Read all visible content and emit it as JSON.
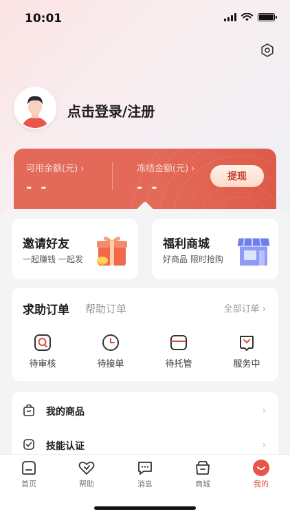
{
  "status_bar": {
    "time": "10:01"
  },
  "profile": {
    "login_text": "点击登录/注册"
  },
  "balance": {
    "available_label": "可用余额(元) ›",
    "available_value": "- -",
    "frozen_label": "冻结金额(元) ›",
    "frozen_value": "- -",
    "withdraw_label": "提现"
  },
  "promos": [
    {
      "title": "邀请好友",
      "subtitle": "一起赚钱 一起发",
      "icon": "gift-icon"
    },
    {
      "title": "福利商城",
      "subtitle": "好商品 限时抢购",
      "icon": "shop-icon"
    }
  ],
  "orders": {
    "title": "求助订单",
    "tab2": "帮助订单",
    "view_all": "全部订单 ›",
    "items": [
      {
        "label": "待审核",
        "icon": "review-icon"
      },
      {
        "label": "待接单",
        "icon": "clock-icon"
      },
      {
        "label": "待托管",
        "icon": "wallet-icon"
      },
      {
        "label": "服务中",
        "icon": "service-icon"
      }
    ]
  },
  "menu": [
    {
      "label": "我的商品",
      "icon": "bag-icon"
    },
    {
      "label": "技能认证",
      "icon": "check-shield-icon"
    }
  ],
  "tabbar": [
    {
      "label": "首页",
      "icon": "home-icon",
      "active": false
    },
    {
      "label": "帮助",
      "icon": "heart-icon",
      "active": false
    },
    {
      "label": "消息",
      "icon": "message-icon",
      "active": false
    },
    {
      "label": "商城",
      "icon": "store-icon",
      "active": false
    },
    {
      "label": "我的",
      "icon": "me-icon",
      "active": true
    }
  ],
  "colors": {
    "accent": "#e04a3a",
    "card": "#e36a58"
  }
}
